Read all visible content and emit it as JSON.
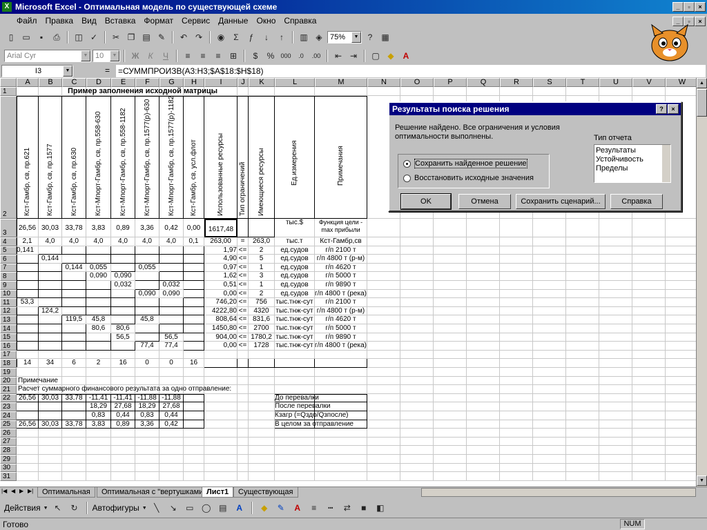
{
  "window": {
    "title": "Microsoft Excel - Оптимальная модель по существующей схеме"
  },
  "menu": [
    "Файл",
    "Правка",
    "Вид",
    "Вставка",
    "Формат",
    "Сервис",
    "Данные",
    "Окно",
    "Справка"
  ],
  "toolbar": {
    "zoom": "75%",
    "font": "Arial Cyr",
    "size": "10",
    "bold": "Ж",
    "italic": "К",
    "underline": "Ч",
    "percent": "%",
    "thousands": "000"
  },
  "formula": {
    "cell_ref": "I3",
    "equals": "=",
    "content": "=СУММПРОИЗВ(A3:H3;$A$18:$H$18)"
  },
  "columns": [
    "A",
    "B",
    "C",
    "D",
    "E",
    "F",
    "G",
    "H",
    "I",
    "J",
    "K",
    "L",
    "M",
    "N",
    "O",
    "P",
    "Q",
    "R",
    "S",
    "T",
    "U",
    "V",
    "W"
  ],
  "rows": [
    "1",
    "2",
    "3",
    "4",
    "5",
    "6",
    "7",
    "8",
    "9",
    "10",
    "11",
    "12",
    "13",
    "14",
    "15",
    "16",
    "17",
    "18",
    "19",
    "20",
    "21",
    "22",
    "23",
    "24",
    "25",
    "26",
    "27",
    "28",
    "29",
    "30",
    "31"
  ],
  "sheet": {
    "title": "Пример заполнения исходной матрицы",
    "headers": [
      "Кст-Гамбр, св, пр.621",
      "Кст-Гамбр, св, пр.1577",
      "Кст-Гамбр, св, пр.630",
      "Кст-Мпорт-Гамбр, св, пр.558-630",
      "Кст-Мпорт-Гамбр, св, пр.558-1182",
      "Кст-Мпорт-Гамбр, св, пр.1577(р)-630",
      "Кст-Мпорт-Гамбр, св, пр.1577(р)-1182",
      "Кст-Гамбр, св, усл.флот",
      "Использованные ресурсы",
      "Тип ограничений",
      "Имеющиеся ресурсы",
      "Ед.измерения",
      "Примечания"
    ],
    "row3": [
      "26,56",
      "30,03",
      "33,78",
      "3,83",
      "0,89",
      "3,36",
      "0,42",
      "0,00",
      "1617,48",
      "",
      "",
      "тыс.$",
      "Функция цели - max прибыли"
    ],
    "row4": [
      "2,1",
      "4,0",
      "4,0",
      "4,0",
      "4,0",
      "4,0",
      "4,0",
      "0,1",
      "263,00",
      "=",
      "263,0",
      "тыс.т",
      "Кст-Гамбр,св"
    ],
    "body": [
      {
        "r": 5,
        "c": {
          "A": "0,141",
          "I": "1,97",
          "J": "<=",
          "K": "2",
          "L": "ед.судов",
          "M": "г/п 2100 т"
        }
      },
      {
        "r": 6,
        "c": {
          "B": "0,144",
          "I": "4,90",
          "J": "<=",
          "K": "5",
          "L": "ед.судов",
          "M": "г/п 4800 т (р-м)"
        }
      },
      {
        "r": 7,
        "c": {
          "C": "0,144",
          "D": "0,055",
          "F": "0,055",
          "I": "0,97",
          "J": "<=",
          "K": "1",
          "L": "ед.судов",
          "M": "г/п 4620 т"
        }
      },
      {
        "r": 8,
        "c": {
          "D": "0,090",
          "E": "0,090",
          "I": "1,62",
          "J": "<=",
          "K": "3",
          "L": "ед.судов",
          "M": "г/п 5000 т"
        }
      },
      {
        "r": 9,
        "c": {
          "E": "0,032",
          "G": "0,032",
          "I": "0,51",
          "J": "<=",
          "K": "1",
          "L": "ед.судов",
          "M": "г/п 9890 т"
        }
      },
      {
        "r": 10,
        "c": {
          "F": "0,090",
          "G": "0,090",
          "I": "0,00",
          "J": "<=",
          "K": "2",
          "L": "ед.судов",
          "M": "г/п 4800 т (река)"
        }
      },
      {
        "r": 11,
        "c": {
          "A": "53,3",
          "I": "746,20",
          "J": "<=",
          "K": "756",
          "L": "тыс.тнж-сут",
          "M": "г/п 2100 т"
        }
      },
      {
        "r": 12,
        "c": {
          "B": "124,2",
          "I": "4222,80",
          "J": "<=",
          "K": "4320",
          "L": "тыс.тнж-сут",
          "M": "г/п 4800 т (р-м)"
        }
      },
      {
        "r": 13,
        "c": {
          "C": "119,5",
          "D": "45,8",
          "F": "45,8",
          "I": "808,64",
          "J": "<=",
          "K": "831,6",
          "L": "тыс.тнж-сут",
          "M": "г/п 4620 т"
        }
      },
      {
        "r": 14,
        "c": {
          "D": "80,6",
          "E": "80,6",
          "I": "1450,80",
          "J": "<=",
          "K": "2700",
          "L": "тыс.тнж-сут",
          "M": "г/п 5000 т"
        }
      },
      {
        "r": 15,
        "c": {
          "E": "56,5",
          "G": "56,5",
          "I": "904,00",
          "J": "<=",
          "K": "1780,2",
          "L": "тыс.тнж-сут",
          "M": "г/п 9890 т"
        }
      },
      {
        "r": 16,
        "c": {
          "F": "77,4",
          "G": "77,4",
          "I": "0,00",
          "J": "<=",
          "K": "1728",
          "L": "тыс.тнж-сут",
          "M": "г/п 4800 т (река)"
        }
      },
      {
        "r": 18,
        "c": {
          "A": "14",
          "B": "34",
          "C": "6",
          "D": "2",
          "E": "16",
          "F": "0",
          "G": "0",
          "H": "16"
        }
      },
      {
        "r": 22,
        "c": {
          "A": "26,56",
          "B": "30,03",
          "C": "33,78",
          "D": "-11,41",
          "E": "-11,41",
          "F": "-11,88",
          "G": "-11,88",
          "L": "До перевалки"
        }
      },
      {
        "r": 23,
        "c": {
          "D": "18,29",
          "E": "27,68",
          "F": "18,29",
          "G": "27,68",
          "L": "После перевалки"
        }
      },
      {
        "r": 24,
        "c": {
          "D": "0,83",
          "E": "0,44",
          "F": "0,83",
          "G": "0,44",
          "L": "Кзагр (=Qздо/Qзпосле)"
        }
      },
      {
        "r": 25,
        "c": {
          "A": "26,56",
          "B": "30,03",
          "C": "33,78",
          "D": "3,83",
          "E": "0,89",
          "F": "3,36",
          "G": "0,42",
          "L": "В целом за отправление"
        }
      }
    ],
    "note": "Примечание",
    "calc_label": "Расчет суммарного финансового результата за одно отправление:"
  },
  "dialog": {
    "title": "Результаты поиска решения",
    "message": "Решение найдено. Все ограничения и условия оптимальности выполнены.",
    "report_label": "Тип отчета",
    "reports": [
      "Результаты",
      "Устойчивость",
      "Пределы"
    ],
    "option_keep": "Сохранить найденное решение",
    "option_restore": "Восстановить исходные значения",
    "ok": "OK",
    "cancel": "Отмена",
    "save_scenario": "Сохранить сценарий...",
    "help": "Справка"
  },
  "tabs": [
    "Оптимальная",
    "Оптимальная с \"вертушками\"",
    "Лист1",
    "Существующая"
  ],
  "drawbar": {
    "actions": "Действия",
    "autoshapes": "Автофигуры"
  },
  "status": {
    "ready": "Готово",
    "num": "NUM"
  }
}
